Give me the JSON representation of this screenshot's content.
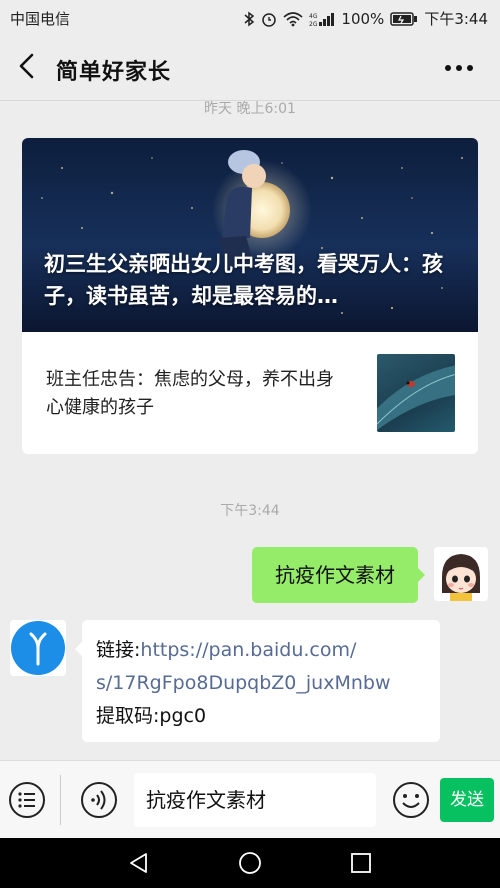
{
  "status": {
    "carrier": "中国电信",
    "battery": "100%",
    "time": "下午3:44"
  },
  "header": {
    "title": "简单好家长"
  },
  "timestamps": {
    "first": "昨天 晚上6:01",
    "second": "下午3:44"
  },
  "article_card": {
    "main_title": "初三生父亲晒出女儿中考图，看哭万人：孩子，读书虽苦，却是最容易的…",
    "sub_title": "班主任忠告：焦虑的父母，养不出身心健康的孩子"
  },
  "messages": {
    "sent": "抗疫作文素材",
    "received_link_label": "链接:",
    "received_link_1": "https://pan.baidu.com/",
    "received_link_2": "s/17RgFpo8DupqbZ0_juxMnbw",
    "received_code": "提取码:pgc0"
  },
  "input": {
    "value": "抗疫作文素材",
    "send_label": "发送"
  },
  "colors": {
    "bubble_green": "#95ec69",
    "send_green": "#07c160",
    "link_blue": "#576b95"
  }
}
